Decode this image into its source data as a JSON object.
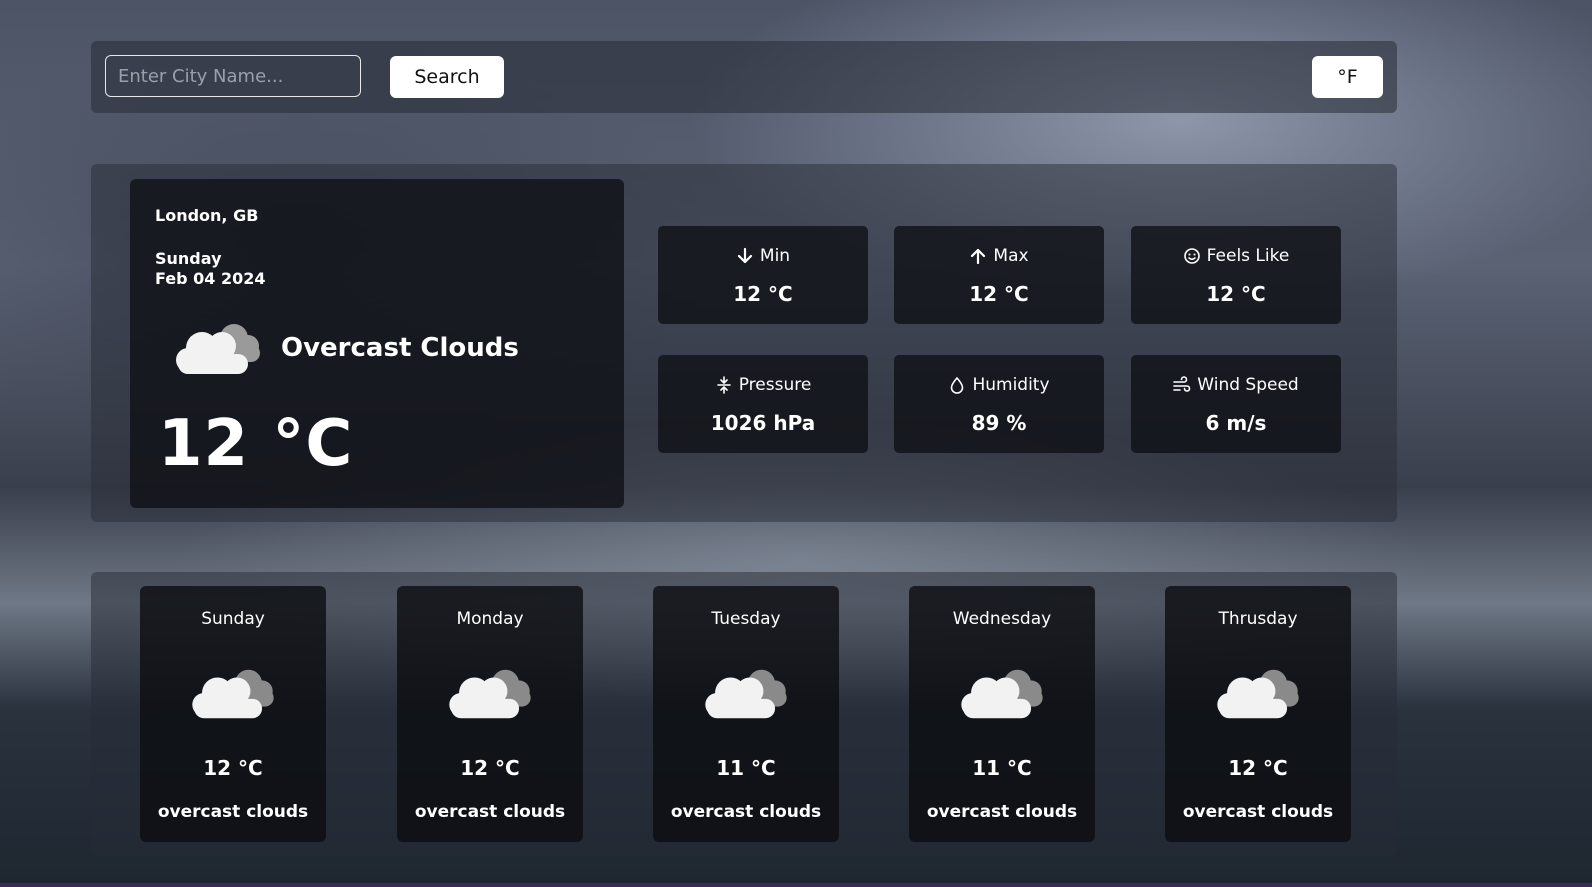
{
  "search": {
    "placeholder": "Enter City Name...",
    "value": "",
    "button_label": "Search"
  },
  "unit_toggle": {
    "label": "°F"
  },
  "current": {
    "location": "London, GB",
    "day": "Sunday",
    "date": "Feb 04 2024",
    "condition": "Overcast Clouds",
    "condition_icon": "cloud-icon",
    "temperature": "12 °C"
  },
  "stats": [
    {
      "label": "Min",
      "value": "12 °C",
      "icon": "arrow-down-icon"
    },
    {
      "label": "Max",
      "value": "12 °C",
      "icon": "arrow-up-icon"
    },
    {
      "label": "Feels Like",
      "value": "12 °C",
      "icon": "smiley-icon"
    },
    {
      "label": "Pressure",
      "value": "1026 hPa",
      "icon": "pressure-icon"
    },
    {
      "label": "Humidity",
      "value": "89 %",
      "icon": "droplet-icon"
    },
    {
      "label": "Wind Speed",
      "value": "6 m/s",
      "icon": "wind-icon"
    }
  ],
  "forecast": [
    {
      "day": "Sunday",
      "temp": "12 °C",
      "desc": "overcast clouds",
      "icon": "cloud-icon"
    },
    {
      "day": "Monday",
      "temp": "12 °C",
      "desc": "overcast clouds",
      "icon": "cloud-icon"
    },
    {
      "day": "Tuesday",
      "temp": "11 °C",
      "desc": "overcast clouds",
      "icon": "cloud-icon"
    },
    {
      "day": "Wednesday",
      "temp": "11 °C",
      "desc": "overcast clouds",
      "icon": "cloud-icon"
    },
    {
      "day": "Thrusday",
      "temp": "12 °C",
      "desc": "overcast clouds",
      "icon": "cloud-icon"
    }
  ],
  "colors": {
    "card_bg": "#0e0f14",
    "button_bg": "#ffffff",
    "text": "#ffffff"
  }
}
